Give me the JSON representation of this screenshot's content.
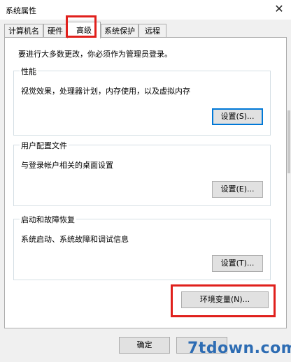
{
  "window": {
    "title": "系统属性",
    "close_symbol": "✕"
  },
  "tabs": [
    {
      "label": "计算机名",
      "active": false
    },
    {
      "label": "硬件",
      "active": false
    },
    {
      "label": "高级",
      "active": true
    },
    {
      "label": "系统保护",
      "active": false
    },
    {
      "label": "远程",
      "active": false
    }
  ],
  "admin_note": "要进行大多数更改，你必须作为管理员登录。",
  "performance": {
    "legend": "性能",
    "description": "视觉效果，处理器计划，内存使用，以及虚拟内存",
    "button": "设置(S)..."
  },
  "user_profiles": {
    "legend": "用户配置文件",
    "description": "与登录帐户相关的桌面设置",
    "button": "设置(E)..."
  },
  "startup_recovery": {
    "legend": "启动和故障恢复",
    "description": "系统启动、系统故障和调试信息",
    "button": "设置(T)..."
  },
  "env_button": "环境变量(N)...",
  "footer": {
    "ok_button": "确定"
  },
  "watermark": "7tdown.com",
  "colors": {
    "highlight": "#e0201c",
    "focus": "#0078d7",
    "watermark": "#2d6cb3"
  }
}
